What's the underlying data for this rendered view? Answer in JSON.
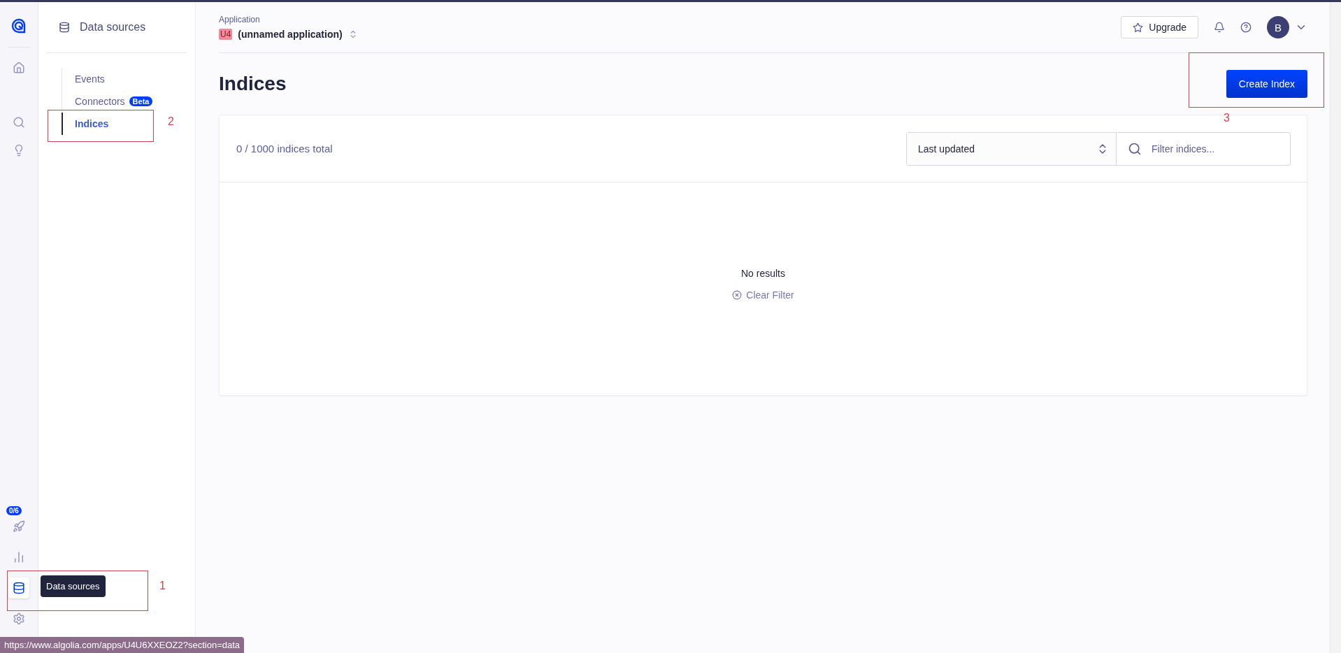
{
  "rail": {
    "items": [
      {
        "kind": "home",
        "selected": false
      },
      {
        "kind": "search",
        "selected": false
      },
      {
        "kind": "bulb",
        "selected": false
      }
    ],
    "bottom_items": [
      {
        "kind": "rocket",
        "selected": false,
        "badge": "0/6"
      },
      {
        "kind": "chart",
        "selected": false
      },
      {
        "kind": "database",
        "selected": true,
        "tooltip": "Data sources"
      },
      {
        "kind": "gear",
        "selected": false
      }
    ]
  },
  "sidebar": {
    "title": "Data sources",
    "items": [
      {
        "label": "Events",
        "selected": false
      },
      {
        "label": "Connectors",
        "selected": false,
        "badge": "Beta"
      },
      {
        "label": "Indices",
        "selected": true
      }
    ]
  },
  "header": {
    "app_label": "Application",
    "app_code": "U4",
    "app_name": "(unnamed application)",
    "upgrade": "Upgrade",
    "avatar": "B"
  },
  "page": {
    "title": "Indices",
    "create_button": "Create Index"
  },
  "card": {
    "count": "0 / 1000 indices total",
    "sort": "Last updated",
    "search": {
      "placeholder": "Filter indices..."
    },
    "empty": "No results",
    "clear": "Clear Filter"
  },
  "status_url": "https://www.algolia.com/apps/U4U6XXEOZ2?section=data",
  "annotations": [
    {
      "label": "1",
      "kind": "rail"
    },
    {
      "label": "2",
      "kind": "sidebar"
    },
    {
      "label": "3",
      "kind": "create"
    }
  ]
}
